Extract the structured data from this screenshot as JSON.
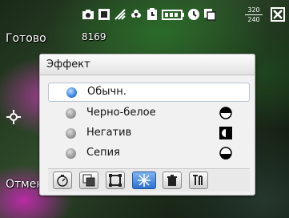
{
  "status": {
    "icons": [
      "camera-icon",
      "frame-icon",
      "antenna-icon",
      "flower-icon",
      "timer-icon",
      "battery-icon",
      "clock-icon",
      "copy-icon"
    ],
    "resolution_top": "320",
    "resolution_bottom": "240",
    "close_icon": "close-icon"
  },
  "left_softkey": "Готово",
  "counter": "8169",
  "right_softkey": "Отмена",
  "focus_icon": "focus-icon",
  "dialog": {
    "title": "Эффект",
    "options": [
      {
        "label": "Обычн.",
        "selected": true,
        "icon": ""
      },
      {
        "label": "Черно-белое",
        "selected": false,
        "icon": "bw-icon"
      },
      {
        "label": "Негатив",
        "selected": false,
        "icon": "negative-icon"
      },
      {
        "label": "Сепия",
        "selected": false,
        "icon": "sepia-icon"
      }
    ],
    "toolbar": [
      "timer-icon",
      "layers-icon",
      "frame-icon",
      "sparkle-icon",
      "trash-icon",
      "tools-icon"
    ],
    "active_toolbar_index": 3
  },
  "colors": {
    "accent": "#3b82e0",
    "panel": "#f1f1f1"
  }
}
